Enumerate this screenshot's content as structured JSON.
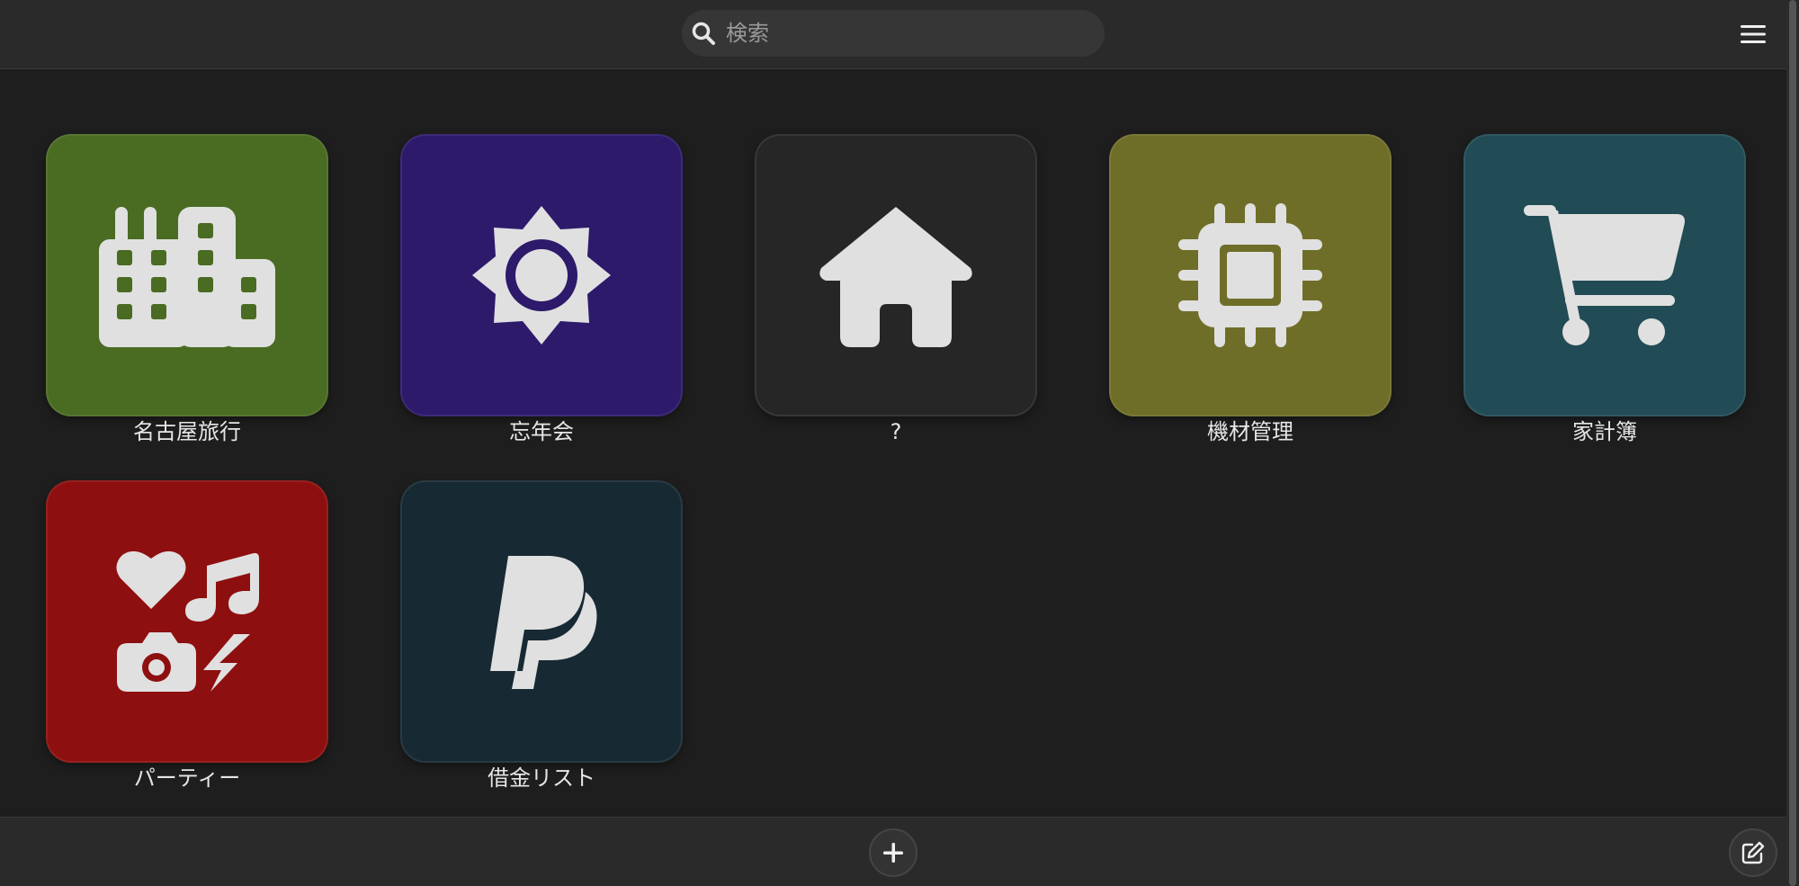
{
  "search": {
    "placeholder": "検索",
    "icon": "search-icon"
  },
  "header": {
    "menu_icon": "hamburger-menu-icon"
  },
  "tiles": [
    {
      "label": "名古屋旅行",
      "icon": "city-buildings-icon",
      "color": "#4a6b22"
    },
    {
      "label": "忘年会",
      "icon": "sun-icon",
      "color": "#2d1a6b"
    },
    {
      "label": "?",
      "icon": "home-icon",
      "color": "#262626"
    },
    {
      "label": "機材管理",
      "icon": "microchip-icon",
      "color": "#6f6e28"
    },
    {
      "label": "家計簿",
      "icon": "shopping-cart-icon",
      "color": "#214b55"
    },
    {
      "label": "パーティー",
      "icon": "icons-heart-music-camera-bolt-icon",
      "color": "#8e0f0f"
    },
    {
      "label": "借金リスト",
      "icon": "paypal-icon",
      "color": "#172a33"
    }
  ],
  "footer": {
    "add_icon": "plus-icon",
    "edit_icon": "edit-icon"
  },
  "colors": {
    "icon_fill": "#e0e0e0",
    "background": "#1e1e1e",
    "bar": "#2a2a2a"
  }
}
